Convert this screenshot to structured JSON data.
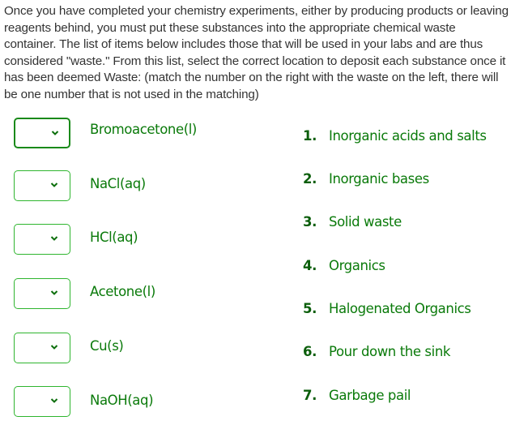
{
  "instructions": "Once you have completed your chemistry experiments, either by producing products or leaving reagents behind, you must put these substances into the appropriate chemical waste container. The list of items below includes those that will be used in your labs and are thus considered \"waste.\" From this list, select the correct location to deposit each substance once it has been deemed Waste: (match the number on the right with the waste on the left, there will be one number that is not used in the matching)",
  "colors": {
    "accent_green": "#0a7a0a",
    "border_green": "#2fb52f",
    "focused_border": "#1a8a1a",
    "text_gray": "#333333"
  },
  "items": [
    {
      "label": "Bromoacetone(l)",
      "selected": "",
      "focused": true
    },
    {
      "label": "NaCl(aq)",
      "selected": "",
      "focused": false
    },
    {
      "label": "HCl(aq)",
      "selected": "",
      "focused": false
    },
    {
      "label": "Acetone(l)",
      "selected": "",
      "focused": false
    },
    {
      "label": "Cu(s)",
      "selected": "",
      "focused": false
    },
    {
      "label": "NaOH(aq)",
      "selected": "",
      "focused": false
    }
  ],
  "options": [
    {
      "number": "1.",
      "label": "Inorganic acids and salts"
    },
    {
      "number": "2.",
      "label": "Inorganic bases"
    },
    {
      "number": "3.",
      "label": "Solid waste"
    },
    {
      "number": "4.",
      "label": "Organics"
    },
    {
      "number": "5.",
      "label": "Halogenated Organics"
    },
    {
      "number": "6.",
      "label": "Pour down the sink"
    },
    {
      "number": "7.",
      "label": "Garbage pail"
    }
  ],
  "icons": {
    "dropdown": "chevron-down-icon"
  }
}
